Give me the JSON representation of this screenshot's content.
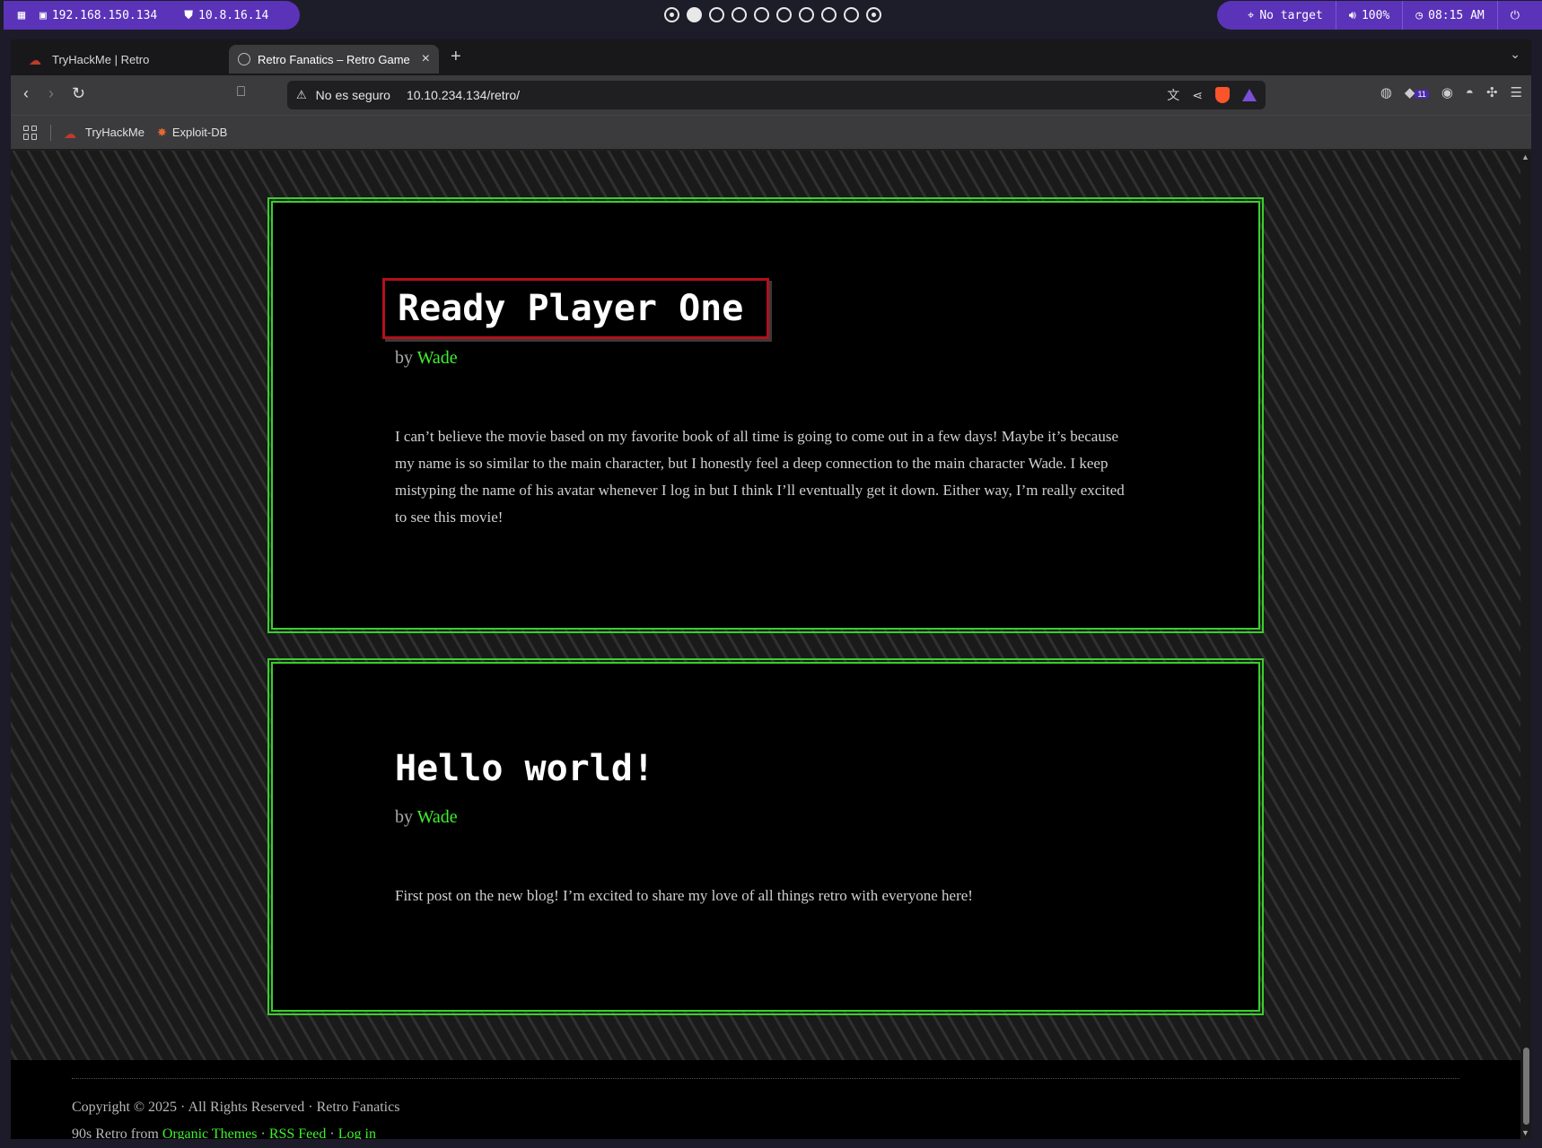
{
  "system_bar": {
    "ip_primary": "192.168.150.134",
    "ip_vpn": "10.8.16.14",
    "target": "No target",
    "volume": "100%",
    "clock": "08:15 AM",
    "workspaces": [
      "dotted",
      "active",
      "empty",
      "empty",
      "empty",
      "empty",
      "empty",
      "empty",
      "empty",
      "dotted"
    ],
    "accent_color": "#5b33b8"
  },
  "browser": {
    "tabs": [
      {
        "label": "TryHackMe | Retro",
        "active": false
      },
      {
        "label": "Retro Fanatics – Retro Game",
        "active": true
      }
    ],
    "security_label": "No es seguro",
    "url": "10.10.234.134/retro/",
    "extension_badge": "11",
    "bookmarks": [
      {
        "label": "TryHackMe"
      },
      {
        "label": "Exploit-DB"
      }
    ]
  },
  "posts": [
    {
      "title": "Ready Player One",
      "by_prefix": "by",
      "author": "Wade",
      "body": "I can’t believe the movie based on my favorite book of all time is going to come out in a few days! Maybe it’s because my name is so similar to the main character, but I honestly feel a deep connection to the main character Wade. I keep mistyping the name of his avatar whenever I log in but I think I’ll eventually get it down. Either way, I’m really excited to see this movie!"
    },
    {
      "title": "Hello world!",
      "by_prefix": "by",
      "author": "Wade",
      "body": "First post on the new blog! I’m excited to share my love of all things retro with everyone here!"
    }
  ],
  "footer": {
    "copyright": "Copyright © 2025 · All Rights Reserved · Retro Fanatics",
    "theme_prefix": "90s Retro from",
    "theme_link": "Organic Themes",
    "sep": "·",
    "rss": "RSS Feed",
    "login": "Log in"
  },
  "colors": {
    "post_border": "#39d02b",
    "link": "#3ef02e",
    "highlight_border": "#b3101a"
  }
}
